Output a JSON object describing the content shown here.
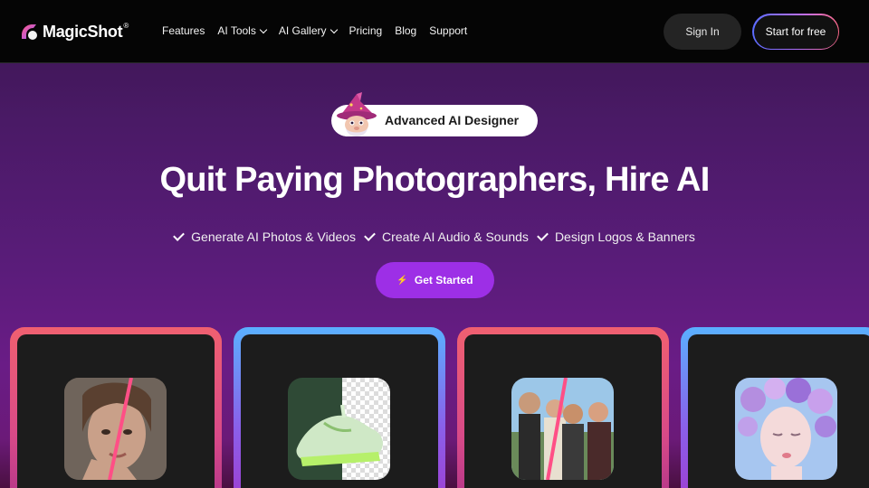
{
  "nav": {
    "logo_text": "MagicShot",
    "logo_reg": "®",
    "links": [
      {
        "label": "Features",
        "has_dropdown": false
      },
      {
        "label": "AI Tools",
        "has_dropdown": true
      },
      {
        "label": "AI Gallery",
        "has_dropdown": true
      },
      {
        "label": "Pricing",
        "has_dropdown": false
      },
      {
        "label": "Blog",
        "has_dropdown": false
      },
      {
        "label": "Support",
        "has_dropdown": false
      }
    ],
    "signin_label": "Sign In",
    "start_label": "Start for free"
  },
  "hero": {
    "badge_label": "Advanced AI Designer",
    "title": "Quit Paying Photographers, Hire AI",
    "features": [
      "Generate AI Photos & Videos",
      "Create AI Audio & Sounds",
      "Design Logos & Banners"
    ],
    "cta_label": "Get Started",
    "cta_icon": "⚡"
  },
  "cards": [
    {
      "name": "portrait-woman",
      "icon": "image-icon"
    },
    {
      "name": "sneaker-background-removal",
      "icon": "image-icon"
    },
    {
      "name": "group-photo",
      "icon": "image-icon"
    },
    {
      "name": "flower-portrait",
      "icon": "image-icon"
    }
  ],
  "colors": {
    "accent": "#9d2fe6",
    "nav_bg": "#050505",
    "card_bg": "#1c1c1c"
  }
}
